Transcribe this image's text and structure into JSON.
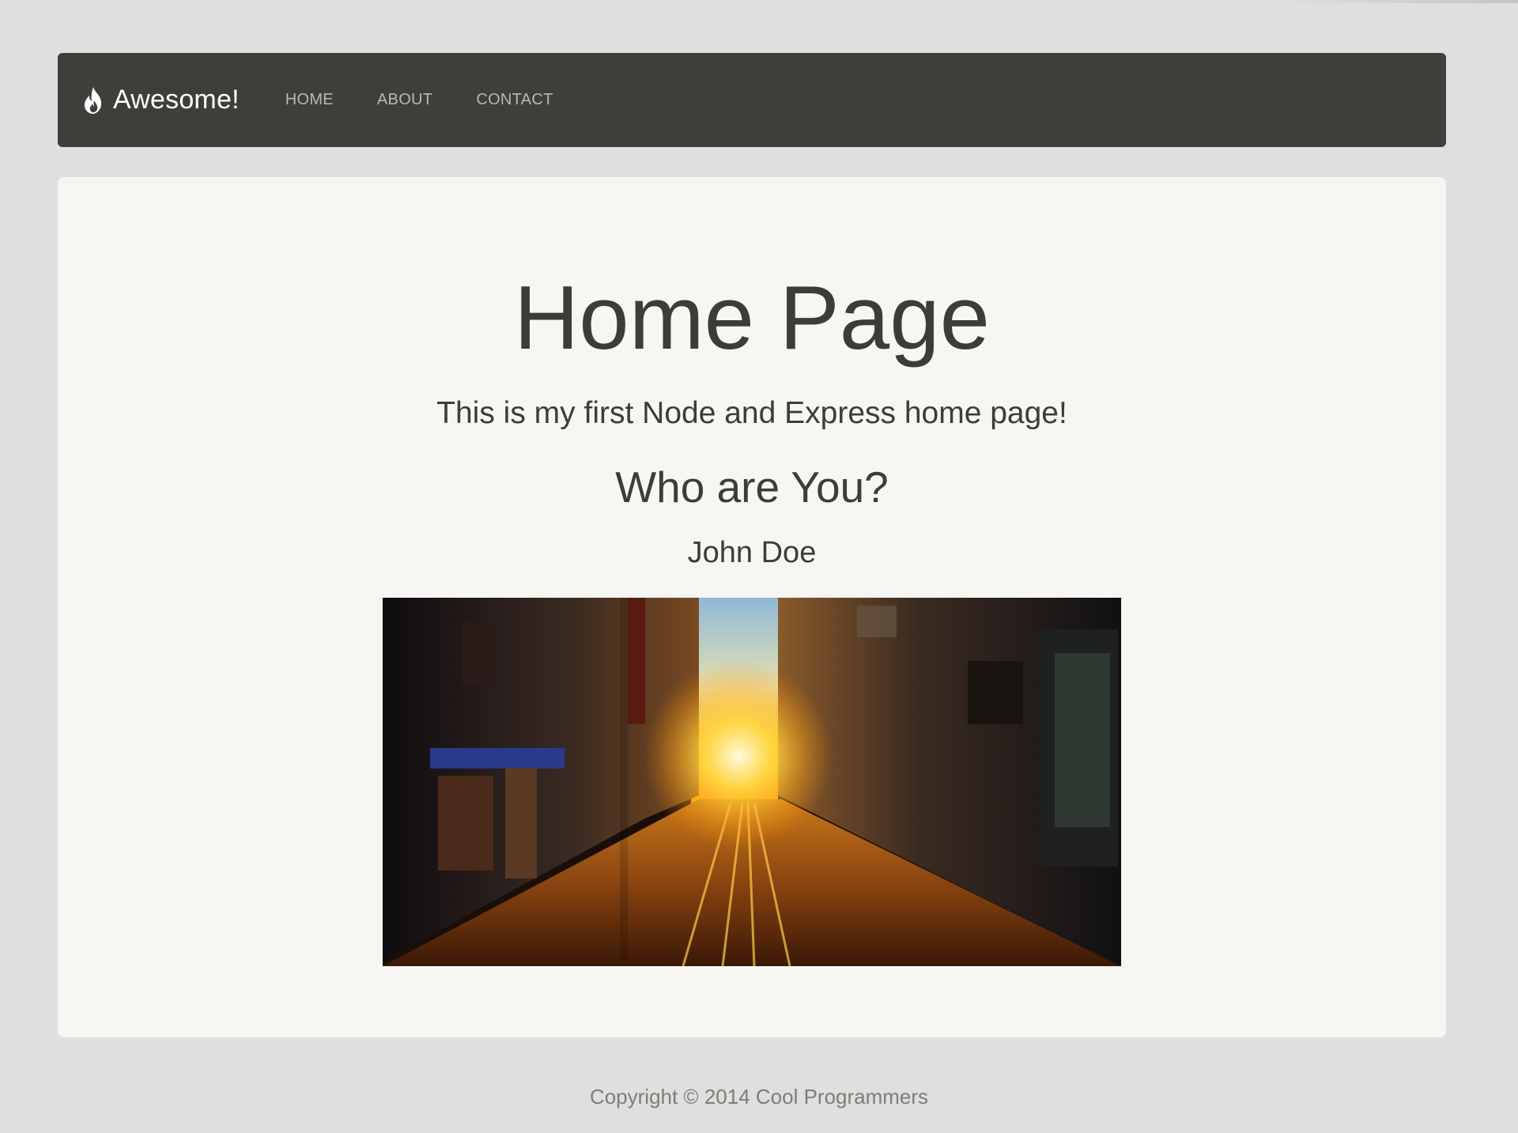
{
  "navbar": {
    "brand": {
      "icon": "flame-icon",
      "label": "Awesome!"
    },
    "links": [
      {
        "label": "HOME"
      },
      {
        "label": "ABOUT"
      },
      {
        "label": "CONTACT"
      }
    ]
  },
  "main": {
    "title": "Home Page",
    "subtitle": "This is my first Node and Express home page!",
    "question": "Who are You?",
    "name": "John Doe",
    "photo": {
      "description_icon": "street-sunset-photo"
    }
  },
  "footer": {
    "copyright": "Copyright © 2014 Cool Programmers"
  },
  "colors": {
    "page_background": "#dfdfdf",
    "navbar_background": "#3e3e3a",
    "panel_background": "#f8f6f2",
    "text": "#3c3c38",
    "nav_link": "#b9b9b1",
    "footer_text": "#7d7d75"
  }
}
